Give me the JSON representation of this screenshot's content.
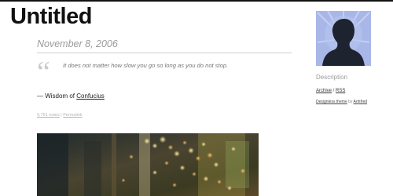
{
  "blog": {
    "title": "Untitled"
  },
  "post": {
    "date": "November 8, 2006",
    "quote_mark": "“",
    "quote": "It does not matter how slow you go so long as you do not stop.",
    "source_prefix": "—  Wisdom of ",
    "source_name": "Confucius",
    "notes_link": "9,751 notes",
    "separator": " | ",
    "permalink": "Permalink"
  },
  "photo": {
    "description": "blurred city night bokeh lights"
  },
  "sidebar": {
    "description": "Description",
    "archive_link": "Archive",
    "link_separator": " / ",
    "rss_link": "RSS",
    "theme_link": "Designless theme",
    "theme_by": " by ",
    "author_link": "Anhfred"
  },
  "colors": {
    "title": "#111111",
    "date": "#9b9b9b",
    "quote_mark": "#cacaca",
    "avatar_bg": "#a9b7e8",
    "avatar_silhouette": "#1e2330"
  }
}
